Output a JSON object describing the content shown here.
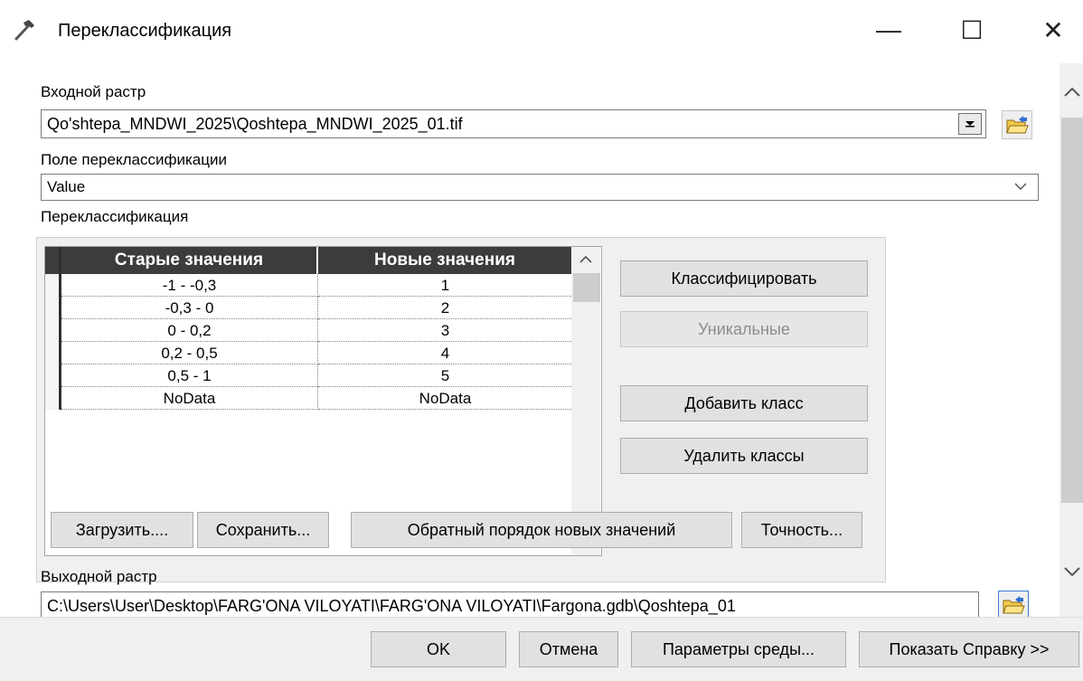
{
  "window": {
    "title": "Переклассификация",
    "minimize_glyph": "—",
    "maximize_glyph": "☐",
    "close_glyph": "✕"
  },
  "input_raster": {
    "label": "Входной растр",
    "value": "Qo'shtepa_MNDWI_2025\\Qoshtepa_MNDWI_2025_01.tif"
  },
  "reclass_field": {
    "label": "Поле переклассификации",
    "value": "Value"
  },
  "reclassification": {
    "label": "Переклассификация",
    "columns": [
      "Старые значения",
      "Новые значения"
    ],
    "rows": [
      [
        "-1 - -0,3",
        "1"
      ],
      [
        "-0,3 - 0",
        "2"
      ],
      [
        "0 - 0,2",
        "3"
      ],
      [
        "0,2 - 0,5",
        "4"
      ],
      [
        "0,5 - 1",
        "5"
      ],
      [
        "NoData",
        "NoData"
      ]
    ],
    "buttons": {
      "classify": "Классифицировать",
      "unique": "Уникальные",
      "add_class": "Добавить класс",
      "delete_classes": "Удалить классы",
      "load": "Загрузить....",
      "save": "Сохранить...",
      "reverse": "Обратный порядок новых значений",
      "precision": "Точность..."
    }
  },
  "output_raster": {
    "label": "Выходной растр",
    "value": "C:\\Users\\User\\Desktop\\FARG'ONA VILOYATI\\FARG'ONA VILOYATI\\Fargona.gdb\\Qoshtepa_01"
  },
  "footer": {
    "ok": "OK",
    "cancel": "Отмена",
    "environments": "Параметры среды...",
    "show_help": "Показать Справку >>"
  },
  "icons": {
    "app": "hammer-icon",
    "folder": "open-folder-icon",
    "dropdown": "chevron-down-icon"
  }
}
